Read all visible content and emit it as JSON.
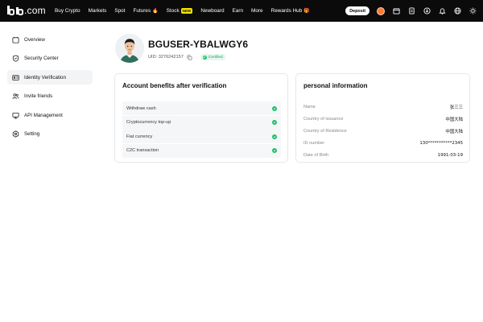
{
  "brand": {
    "logo_mark": "b",
    "logo_suffix": ".com"
  },
  "nav": {
    "items": [
      {
        "label": "Buy Crypto"
      },
      {
        "label": "Markets"
      },
      {
        "label": "Spot"
      },
      {
        "label": "Futures",
        "icon": "fire-icon"
      },
      {
        "label": "Stock",
        "badge": "NEW"
      },
      {
        "label": "Newboard"
      },
      {
        "label": "Earn"
      },
      {
        "label": "More"
      },
      {
        "label": "Rewards Hub",
        "icon": "gift-icon"
      }
    ],
    "deposit_label": "Deposit",
    "right_icons": [
      "avatar",
      "wallet-icon",
      "orders-icon",
      "download-icon",
      "bell-icon",
      "globe-icon",
      "theme-icon"
    ]
  },
  "sidebar": {
    "items": [
      {
        "label": "Overview",
        "icon": "overview-icon",
        "active": false
      },
      {
        "label": "Security Center",
        "icon": "shield-icon",
        "active": false
      },
      {
        "label": "Identity Verification",
        "icon": "id-card-icon",
        "active": true
      },
      {
        "label": "Invite friends",
        "icon": "users-icon",
        "active": false
      },
      {
        "label": "API Management",
        "icon": "monitor-icon",
        "active": false
      },
      {
        "label": "Setting",
        "icon": "gear-icon",
        "active": false
      }
    ]
  },
  "profile": {
    "username": "BGUSER-YBALWGY6",
    "uid_label": "UID: 3276242157",
    "status": "Certified"
  },
  "benefits": {
    "title": "Account benefits after verification",
    "items": [
      {
        "label": "Withdraw cash"
      },
      {
        "label": "Cryptocurrency top-up"
      },
      {
        "label": "Fiat currency"
      },
      {
        "label": "C2C transaction"
      }
    ]
  },
  "personal": {
    "title": "personal information",
    "rows": [
      {
        "label": "Name",
        "value": "张三三"
      },
      {
        "label": "Country of issuance",
        "value": "中国大陆"
      },
      {
        "label": "Country of Residence",
        "value": "中国大陆"
      },
      {
        "label": "ID number",
        "value": "130***********2345"
      },
      {
        "label": "Date of Birth",
        "value": "1991-03-19"
      }
    ]
  },
  "colors": {
    "accent_green": "#1fbf6a",
    "nav_bg": "#0b0b0b",
    "new_badge": "#f2e600"
  }
}
